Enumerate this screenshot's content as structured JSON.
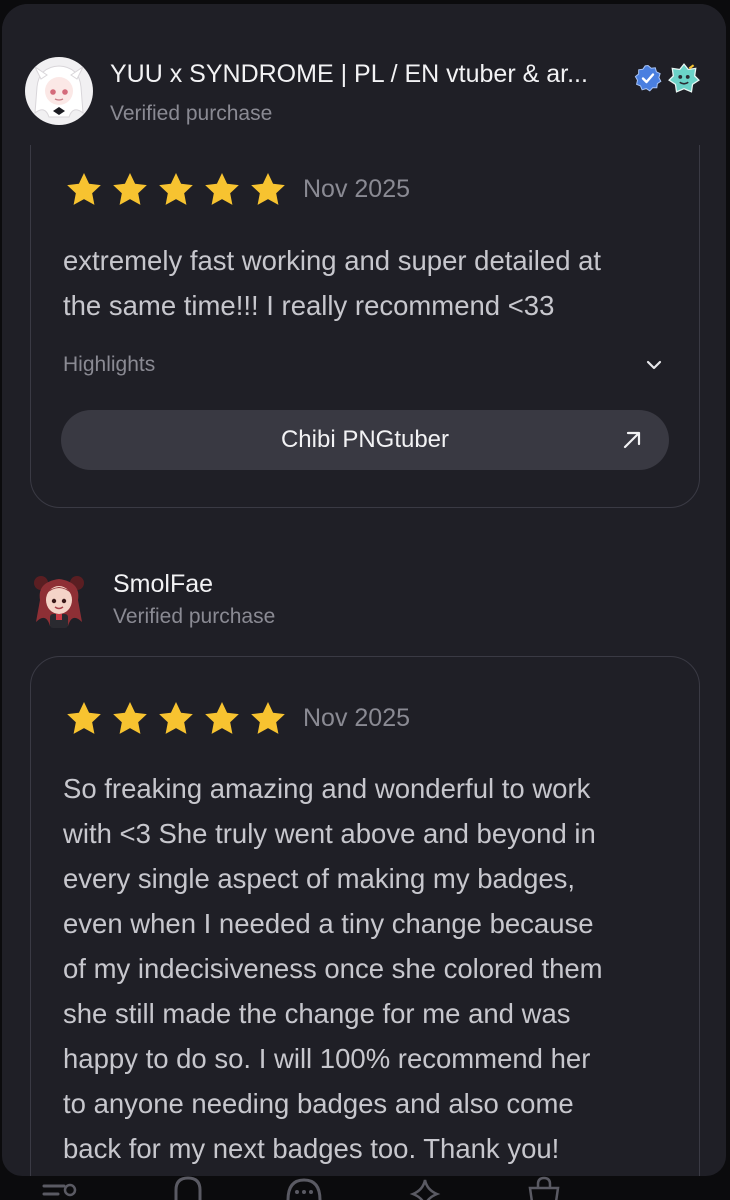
{
  "reviews": [
    {
      "reviewer": "YUU x SYNDROME | PL / EN vtuber & ar...",
      "verified_label": "Verified purchase",
      "rating": 5,
      "date": "Nov 2025",
      "text_lines": [
        "extremely fast working and super detailed at",
        "the same time!!! I really recommend <33"
      ],
      "highlights_label": "Highlights",
      "product_label": "Chibi PNGtuber"
    },
    {
      "reviewer": "SmolFae",
      "verified_label": "Verified purchase",
      "rating": 5,
      "date": "Nov 2025",
      "text_lines": [
        "So freaking amazing and wonderful to work",
        "with <3 She truly went above and beyond in",
        "every single aspect of making my badges,",
        "even when I needed a tiny change because",
        "of my indecisiveness once she colored them",
        "she still made the change for me and was",
        "happy to do so. I will 100% recommend her",
        "to anyone needing badges and also come",
        "back for my next badges too. Thank you!"
      ]
    }
  ],
  "icons": {
    "reviewer1_badges": [
      "verified-check-icon",
      "sticker-badge-icon"
    ],
    "star": "star-icon",
    "expand": "chevron-down-icon",
    "product_link": "arrow-up-right-icon",
    "tabbar": [
      "menu-list-icon",
      "bell-icon",
      "chat-bubble-icon",
      "sparkle-icon",
      "shopping-bag-icon"
    ]
  },
  "colors": {
    "background": "#1f1f26",
    "star": "#f7c330",
    "card_border": "#3a3a44",
    "button": "#393942",
    "verified_badge": "#4a7fe0",
    "text_primary": "#f2f2f4",
    "text_secondary": "#8a8a93"
  }
}
